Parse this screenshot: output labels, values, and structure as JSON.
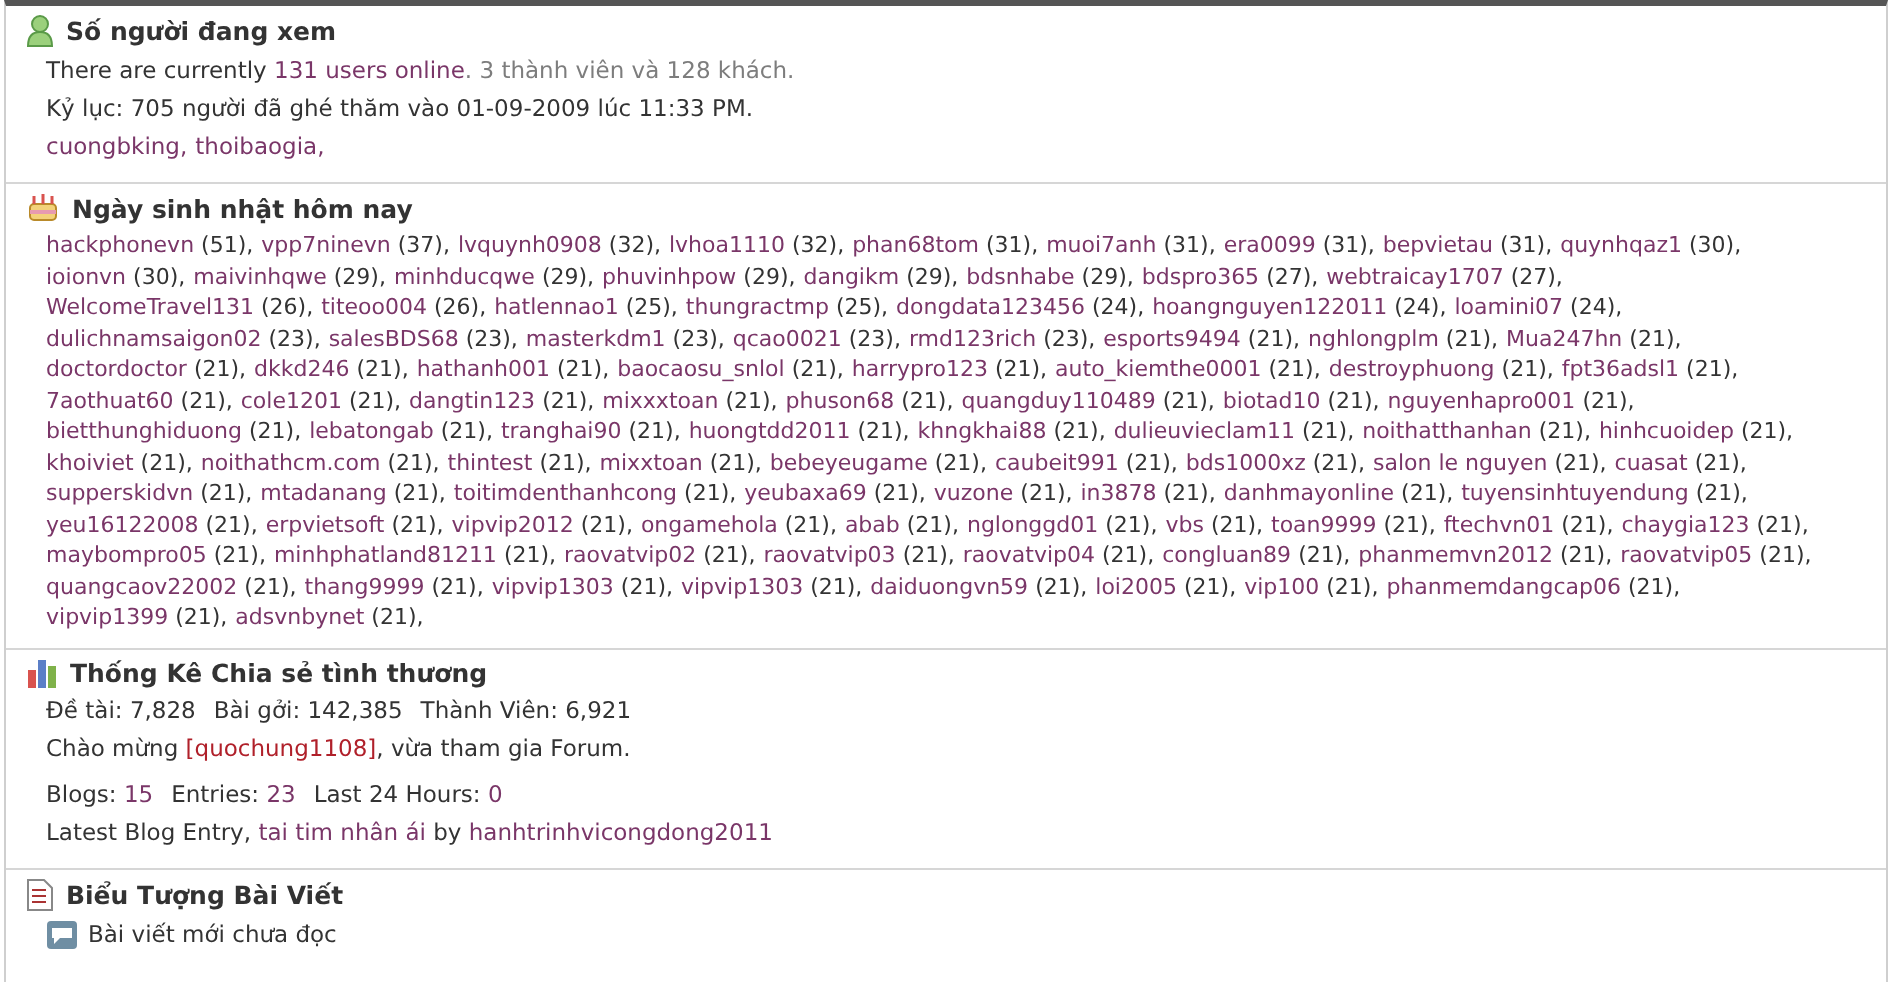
{
  "online": {
    "title": "Số người đang xem",
    "summary": {
      "prefix": "There are currently",
      "link": "131 users online",
      "suffix": ". 3 thành viên và 128 khách."
    },
    "record": "Kỷ lục: 705 người đã ghé thăm vào 01-09-2009 lúc 11:33 PM.",
    "members": [
      "cuongbking,",
      "thoibaogia,"
    ]
  },
  "birthdays": {
    "title": "Ngày sinh nhật hôm nay",
    "users": [
      {
        "name": "hackphonevn",
        "age": "(51),"
      },
      {
        "name": "vpp7ninevn",
        "age": "(37),"
      },
      {
        "name": "lvquynh0908",
        "age": "(32),"
      },
      {
        "name": "lvhoa1110",
        "age": "(32),"
      },
      {
        "name": "phan68tom",
        "age": "(31),"
      },
      {
        "name": "muoi7anh",
        "age": "(31),"
      },
      {
        "name": "era0099",
        "age": "(31),"
      },
      {
        "name": "bepvietau",
        "age": "(31),"
      },
      {
        "name": "quynhqaz1",
        "age": "(30),"
      },
      {
        "name": "ioionvn",
        "age": "(30),"
      },
      {
        "name": "maivinhqwe",
        "age": "(29),"
      },
      {
        "name": "minhducqwe",
        "age": "(29),"
      },
      {
        "name": "phuvinhpow",
        "age": "(29),"
      },
      {
        "name": "dangikm",
        "age": "(29),"
      },
      {
        "name": "bdsnhabe",
        "age": "(29),"
      },
      {
        "name": "bdspro365",
        "age": "(27),"
      },
      {
        "name": "webtraicay1707",
        "age": "(27),"
      },
      {
        "name": "WelcomeTravel131",
        "age": "(26),"
      },
      {
        "name": "titeoo004",
        "age": "(26),"
      },
      {
        "name": "hatlennao1",
        "age": "(25),"
      },
      {
        "name": "thungractmp",
        "age": "(25),"
      },
      {
        "name": "dongdata123456",
        "age": "(24),"
      },
      {
        "name": "hoangnguyen122011",
        "age": "(24),"
      },
      {
        "name": "loamini07",
        "age": "(24),"
      },
      {
        "name": "dulichnamsaigon02",
        "age": "(23),"
      },
      {
        "name": "salesBDS68",
        "age": "(23),"
      },
      {
        "name": "masterkdm1",
        "age": "(23),"
      },
      {
        "name": "qcao0021",
        "age": "(23),"
      },
      {
        "name": "rmd123rich",
        "age": "(23),"
      },
      {
        "name": "esports9494",
        "age": "(21),"
      },
      {
        "name": "nghlongplm",
        "age": "(21),"
      },
      {
        "name": "Mua247hn",
        "age": "(21),"
      },
      {
        "name": "doctordoctor",
        "age": "(21),"
      },
      {
        "name": "dkkd246",
        "age": "(21),"
      },
      {
        "name": "hathanh001",
        "age": "(21),"
      },
      {
        "name": "baocaosu_snlol",
        "age": "(21),"
      },
      {
        "name": "harrypro123",
        "age": "(21),"
      },
      {
        "name": "auto_kiemthe0001",
        "age": "(21),"
      },
      {
        "name": "destroyphuong",
        "age": "(21),"
      },
      {
        "name": "fpt36adsl1",
        "age": "(21),"
      },
      {
        "name": "7aothuat60",
        "age": "(21),"
      },
      {
        "name": "cole1201",
        "age": "(21),"
      },
      {
        "name": "dangtin123",
        "age": "(21),"
      },
      {
        "name": "mixxxtoan",
        "age": "(21),"
      },
      {
        "name": "phuson68",
        "age": "(21),"
      },
      {
        "name": "quangduy110489",
        "age": "(21),"
      },
      {
        "name": "biotad10",
        "age": "(21),"
      },
      {
        "name": "nguyenhapro001",
        "age": "(21),"
      },
      {
        "name": "bietthunghiduong",
        "age": "(21),"
      },
      {
        "name": "lebatongab",
        "age": "(21),"
      },
      {
        "name": "tranghai90",
        "age": "(21),"
      },
      {
        "name": "huongtdd2011",
        "age": "(21),"
      },
      {
        "name": "khngkhai88",
        "age": "(21),"
      },
      {
        "name": "dulieuvieclam11",
        "age": "(21),"
      },
      {
        "name": "noithatthanhan",
        "age": "(21),"
      },
      {
        "name": "hinhcuoidep",
        "age": "(21),"
      },
      {
        "name": "khoiviet",
        "age": "(21),"
      },
      {
        "name": "noithathcm.com",
        "age": "(21),"
      },
      {
        "name": "thintest",
        "age": "(21),"
      },
      {
        "name": "mixxtoan",
        "age": "(21),"
      },
      {
        "name": "bebeyeugame",
        "age": "(21),"
      },
      {
        "name": "caubeit991",
        "age": "(21),"
      },
      {
        "name": "bds1000xz",
        "age": "(21),"
      },
      {
        "name": "salon le nguyen",
        "age": "(21),"
      },
      {
        "name": "cuasat",
        "age": "(21),"
      },
      {
        "name": "supperskidvn",
        "age": "(21),"
      },
      {
        "name": "mtadanang",
        "age": "(21),"
      },
      {
        "name": "toitimdenthanhcong",
        "age": "(21),"
      },
      {
        "name": "yeubaxa69",
        "age": "(21),"
      },
      {
        "name": "vuzone",
        "age": "(21),"
      },
      {
        "name": "in3878",
        "age": "(21),"
      },
      {
        "name": "danhmayonline",
        "age": "(21),"
      },
      {
        "name": "tuyensinhtuyendung",
        "age": "(21),"
      },
      {
        "name": "yeu16122008",
        "age": "(21),"
      },
      {
        "name": "erpvietsoft",
        "age": "(21),"
      },
      {
        "name": "vipvip2012",
        "age": "(21),"
      },
      {
        "name": "ongamehola",
        "age": "(21),"
      },
      {
        "name": "abab",
        "age": "(21),"
      },
      {
        "name": "nglonggd01",
        "age": "(21),"
      },
      {
        "name": "vbs",
        "age": "(21),"
      },
      {
        "name": "toan9999",
        "age": "(21),"
      },
      {
        "name": "ftechvn01",
        "age": "(21),"
      },
      {
        "name": "chaygia123",
        "age": "(21),"
      },
      {
        "name": "maybompro05",
        "age": "(21),"
      },
      {
        "name": "minhphatland81211",
        "age": "(21),"
      },
      {
        "name": "raovatvip02",
        "age": "(21),"
      },
      {
        "name": "raovatvip03",
        "age": "(21),"
      },
      {
        "name": "raovatvip04",
        "age": "(21),"
      },
      {
        "name": "congluan89",
        "age": "(21),"
      },
      {
        "name": "phanmemvn2012",
        "age": "(21),"
      },
      {
        "name": "raovatvip05",
        "age": "(21),"
      },
      {
        "name": "quangcaov22002",
        "age": "(21),"
      },
      {
        "name": "thang9999",
        "age": "(21),"
      },
      {
        "name": "vipvip1303",
        "age": "(21),"
      },
      {
        "name": "vipvip1303",
        "age": "(21),"
      },
      {
        "name": "daiduongvn59",
        "age": "(21),"
      },
      {
        "name": "loi2005",
        "age": "(21),"
      },
      {
        "name": "vip100",
        "age": "(21),"
      },
      {
        "name": "phanmemdangcap06",
        "age": "(21),"
      },
      {
        "name": "vipvip1399",
        "age": "(21),"
      },
      {
        "name": "adsvnbynet",
        "age": "(21),"
      }
    ]
  },
  "stats": {
    "title": "Thống Kê Chia sẻ tình thương",
    "counts": [
      {
        "label": "Đề tài:",
        "value": "7,828"
      },
      {
        "label": "Bài gởi:",
        "value": "142,385"
      },
      {
        "label": "Thành Viên:",
        "value": "6,921"
      }
    ],
    "welcome": {
      "prefix": "Chào mừng",
      "link": "[quochung1108]",
      "suffix": ", vừa tham gia Forum."
    },
    "blogs": [
      {
        "label": "Blogs:",
        "value": "15"
      },
      {
        "label": "Entries:",
        "value": "23"
      },
      {
        "label": "Last 24 Hours:",
        "value": "0"
      }
    ],
    "latest": {
      "prefix": "Latest Blog Entry,",
      "link": "tai tim nhân ái",
      "by": "by",
      "author": "hanhtrinhvicongdong2011"
    }
  },
  "legend": {
    "title": "Biểu Tượng Bài Viết",
    "items": [
      {
        "label": "Bài viết mới chưa đọc"
      }
    ]
  }
}
